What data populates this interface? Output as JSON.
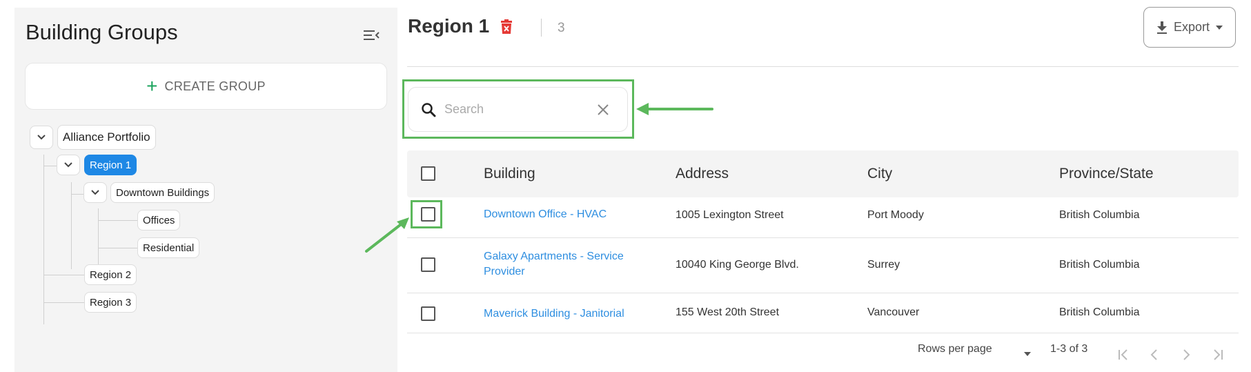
{
  "sidebar": {
    "title": "Building Groups",
    "create_group_label": "CREATE GROUP",
    "tree": {
      "root": "Alliance Portfolio",
      "region1": "Region 1",
      "downtown": "Downtown Buildings",
      "offices": "Offices",
      "residential": "Residential",
      "region2": "Region 2",
      "region3": "Region 3"
    }
  },
  "header": {
    "title": "Region 1",
    "count": "3",
    "export_label": "Export"
  },
  "search": {
    "placeholder": "Search",
    "value": ""
  },
  "table": {
    "columns": [
      "Building",
      "Address",
      "City",
      "Province/State"
    ],
    "rows": [
      {
        "building": "Downtown Office - HVAC",
        "address": "1005 Lexington Street",
        "city": "Port Moody",
        "province": "British Columbia"
      },
      {
        "building": "Galaxy Apartments - Service Provider",
        "address": "10040 King George Blvd.",
        "city": "Surrey",
        "province": "British Columbia"
      },
      {
        "building": "Maverick Building - Janitorial",
        "address": "155 West 20th Street",
        "city": "Vancouver",
        "province": "British Columbia"
      }
    ]
  },
  "pagination": {
    "rows_per_page_label": "Rows per page",
    "range": "1-3 of 3"
  },
  "colors": {
    "accent": "#1e88e5",
    "link": "#2e8ee0",
    "highlight": "#5cb85c",
    "delete": "#e53935",
    "create": "#1aa35c"
  }
}
